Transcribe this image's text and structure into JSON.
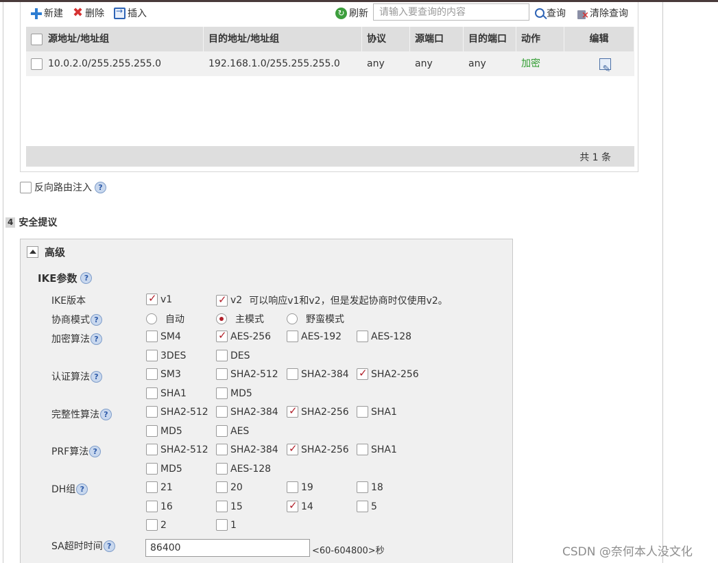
{
  "toolbar": {
    "new_label": "新建",
    "delete_label": "删除",
    "insert_label": "插入",
    "refresh_label": "刷新",
    "search_placeholder": "请输入要查询的内容",
    "search_label": "查询",
    "clear_label": "清除查询"
  },
  "table": {
    "headers": [
      "源地址/地址组",
      "目的地址/地址组",
      "协议",
      "源端口",
      "目的端口",
      "动作",
      "编辑"
    ],
    "rows": [
      {
        "src": "10.0.2.0/255.255.255.0",
        "dst": "192.168.1.0/255.255.255.0",
        "proto": "any",
        "sport": "any",
        "dport": "any",
        "action": "加密"
      }
    ],
    "footer": "共 1 条",
    "action_color": "#2e9b2e"
  },
  "reverse_route": {
    "label": "反向路由注入",
    "checked": false
  },
  "section": {
    "number": "4",
    "title": "安全提议"
  },
  "advanced": {
    "title": "高级",
    "ike_title": "IKE参数",
    "ike_version": {
      "label": "IKE版本",
      "v1": "v1",
      "v2": "v2",
      "note": "可以响应v1和v2，但是发起协商时仅使用v2。"
    },
    "negotiation_mode": {
      "label": "协商模式",
      "options": [
        "自动",
        "主模式",
        "野蛮模式"
      ],
      "selected": "主模式"
    },
    "encryption": {
      "label": "加密算法",
      "options": [
        "SM4",
        "AES-256",
        "AES-192",
        "AES-128",
        "3DES",
        "DES"
      ],
      "checked": [
        "AES-256"
      ]
    },
    "auth": {
      "label": "认证算法",
      "options": [
        "SM3",
        "SHA2-512",
        "SHA2-384",
        "SHA2-256",
        "SHA1",
        "MD5"
      ],
      "checked": [
        "SHA2-256"
      ]
    },
    "integrity": {
      "label": "完整性算法",
      "options": [
        "SHA2-512",
        "SHA2-384",
        "SHA2-256",
        "SHA1",
        "MD5",
        "AES"
      ],
      "checked": [
        "SHA2-256"
      ]
    },
    "prf": {
      "label": "PRF算法",
      "options": [
        "SHA2-512",
        "SHA2-384",
        "SHA2-256",
        "SHA1",
        "MD5",
        "AES-128"
      ],
      "checked": [
        "SHA2-256"
      ]
    },
    "dh": {
      "label": "DH组",
      "options": [
        "21",
        "20",
        "19",
        "18",
        "16",
        "15",
        "14",
        "5",
        "2",
        "1"
      ],
      "checked": [
        "14"
      ]
    },
    "sa_timeout": {
      "label": "SA超时时间",
      "value": "86400",
      "range": "<60-604800>秒"
    }
  },
  "watermark": "CSDN @奈何本人没文化"
}
